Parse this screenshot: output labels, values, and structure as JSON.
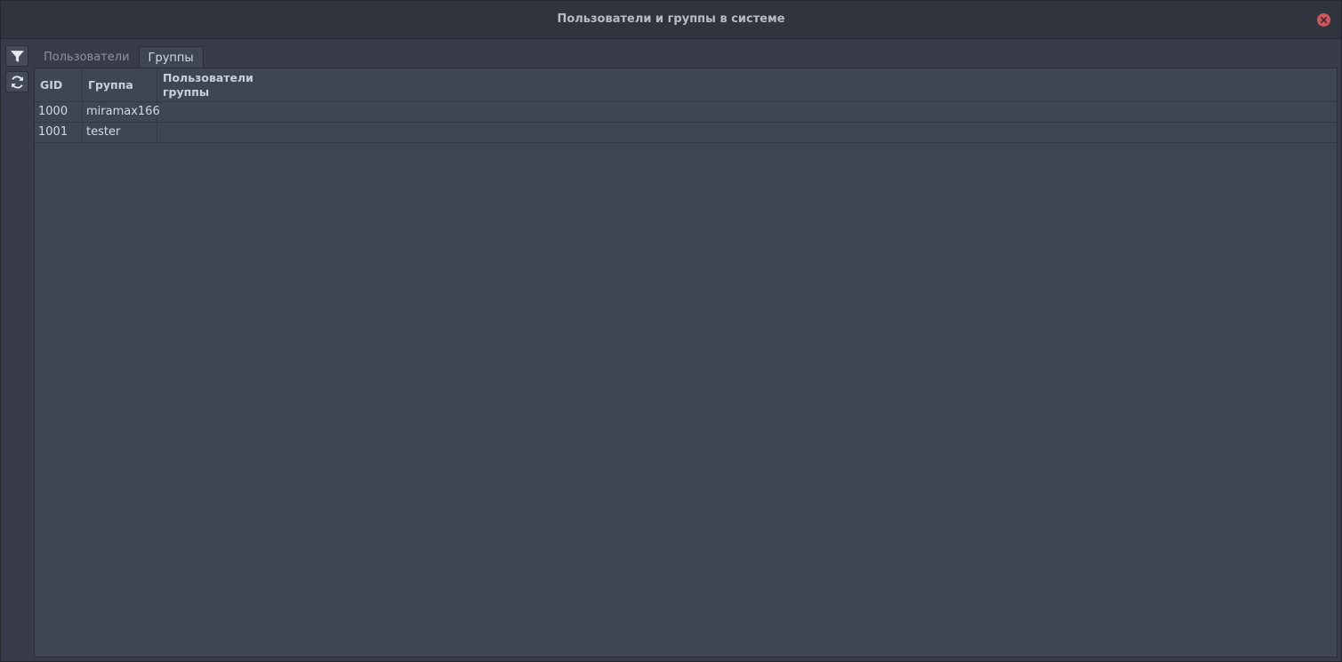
{
  "window": {
    "title": "Пользователи и группы в системе",
    "close_icon": "close-icon",
    "close_color": "#cc575d"
  },
  "toolbar": {
    "filter_icon": "filter-icon",
    "refresh_icon": "refresh-icon"
  },
  "tabs": [
    {
      "label": "Пользователи",
      "active": false
    },
    {
      "label": "Группы",
      "active": true
    }
  ],
  "table": {
    "columns": [
      "GID",
      "Группа",
      "Пользователи группы"
    ],
    "rows": [
      {
        "gid": "1000",
        "group": "miramax166",
        "members": ""
      },
      {
        "gid": "1001",
        "group": "tester",
        "members": ""
      }
    ]
  }
}
